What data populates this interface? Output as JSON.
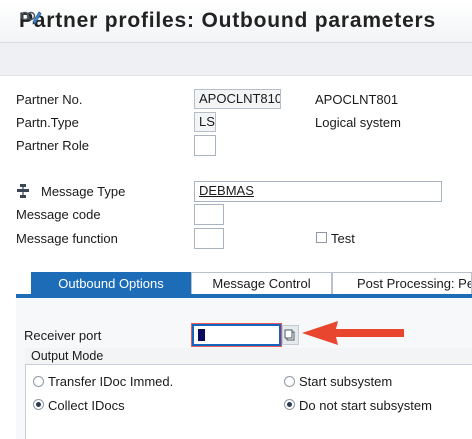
{
  "header": {
    "title": "Partner profiles: Outbound parameters"
  },
  "toolbar": {
    "edit_icon": "display-change-icon"
  },
  "partner": {
    "no_label": "Partner No.",
    "no_value": "APOCLNT810",
    "no_desc": "APOCLNT801",
    "type_label": "Partn.Type",
    "type_value": "LS",
    "type_desc": "Logical system",
    "role_label": "Partner Role",
    "role_value": ""
  },
  "message": {
    "type_icon": "message-type-icon",
    "type_label": "Message Type",
    "type_value": "DEBMAS",
    "code_label": "Message code",
    "code_value": "",
    "function_label": "Message function",
    "function_value": "",
    "test_label": "Test",
    "test_checked": false
  },
  "tabs": [
    {
      "label": "Outbound Options",
      "active": true
    },
    {
      "label": "Message Control",
      "active": false
    },
    {
      "label": "Post Processing: Pe",
      "active": false
    }
  ],
  "outbound": {
    "receiver_port_label": "Receiver port",
    "receiver_port_value": "",
    "output_mode_label": "Output Mode",
    "options": {
      "transfer_immed": "Transfer IDoc Immed.",
      "collect": "Collect IDocs",
      "start_sub": "Start subsystem",
      "no_start_sub": "Do not start subsystem"
    },
    "selected_left": "Collect IDocs",
    "selected_right": "Do not start subsystem"
  },
  "colors": {
    "accent": "#1c6cb8",
    "arrow": "#e8462f"
  }
}
